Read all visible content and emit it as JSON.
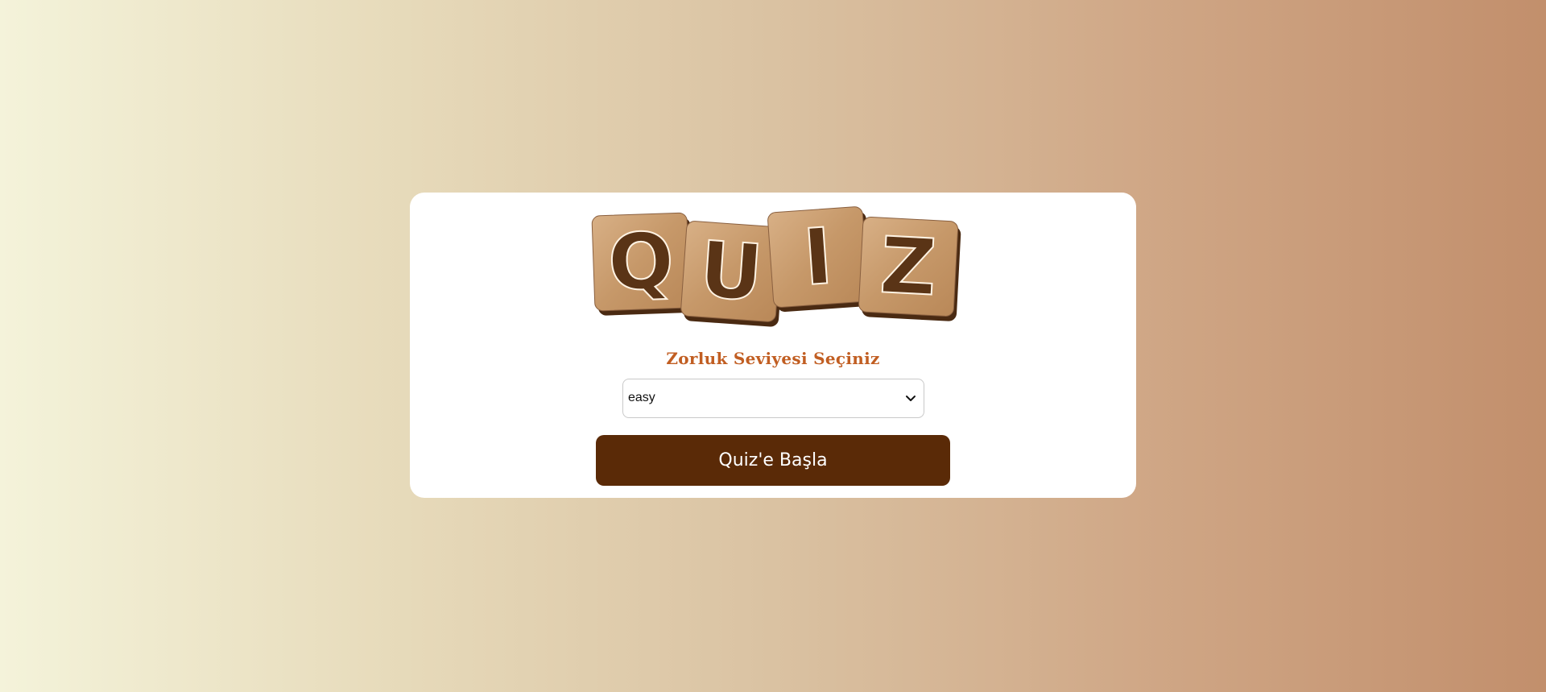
{
  "logo": {
    "letters": [
      "Q",
      "U",
      "I",
      "Z"
    ],
    "tile_color": "#c79a6a",
    "letter_color": "#5a3416"
  },
  "difficulty": {
    "title": "Zorluk Seviyesi Seçiniz",
    "selected": "easy"
  },
  "start_button": {
    "label": "Quiz'e Başla"
  },
  "colors": {
    "title": "#c15e22",
    "button": "#5a2a07",
    "gradient_start": "#f4f3da",
    "gradient_end": "#c28f6c"
  }
}
